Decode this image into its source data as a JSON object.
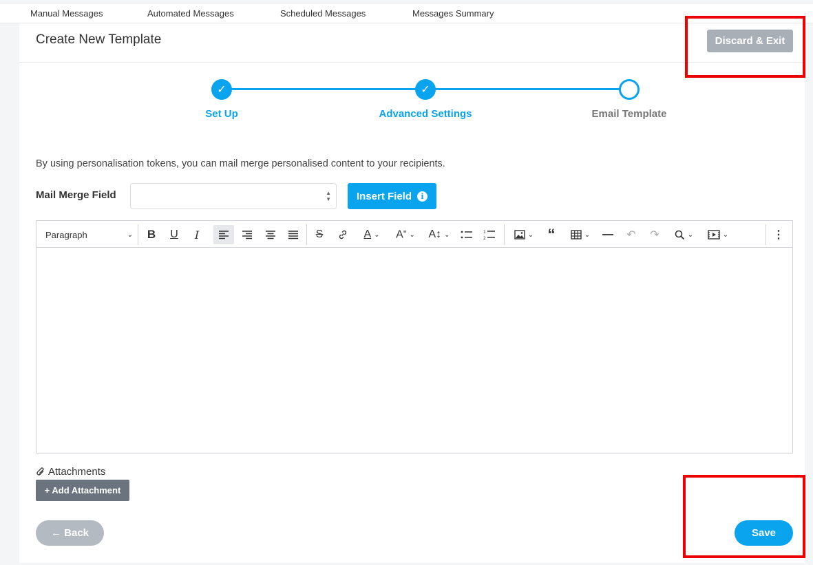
{
  "topnav": {
    "tabs": [
      {
        "label": "Manual Messages"
      },
      {
        "label": "Automated Messages"
      },
      {
        "label": "Scheduled Messages"
      },
      {
        "label": "Messages Summary"
      }
    ]
  },
  "header": {
    "title": "Create New Template",
    "discard_label": "Discard & Exit"
  },
  "stepper": {
    "steps": [
      {
        "label": "Set Up",
        "state": "done",
        "icon": "check-icon"
      },
      {
        "label": "Advanced Settings",
        "state": "done",
        "icon": "check-icon"
      },
      {
        "label": "Email Template",
        "state": "current",
        "icon": ""
      }
    ],
    "check_glyph": "✓"
  },
  "intro_text": "By using personalisation tokens, you can mail merge personalised content to your recipients.",
  "mail_merge": {
    "label": "Mail Merge Field",
    "value": "",
    "insert_label": "Insert Field"
  },
  "editor": {
    "block_format": "Paragraph",
    "content": ""
  },
  "attachments": {
    "label": "Attachments",
    "add_label": "+ Add Attachment"
  },
  "footer": {
    "back_label": "← Back",
    "save_label": "Save"
  },
  "colors": {
    "accent": "#0aa3ee",
    "highlight": "#ee0000",
    "disabled_button": "#a9afb7"
  }
}
